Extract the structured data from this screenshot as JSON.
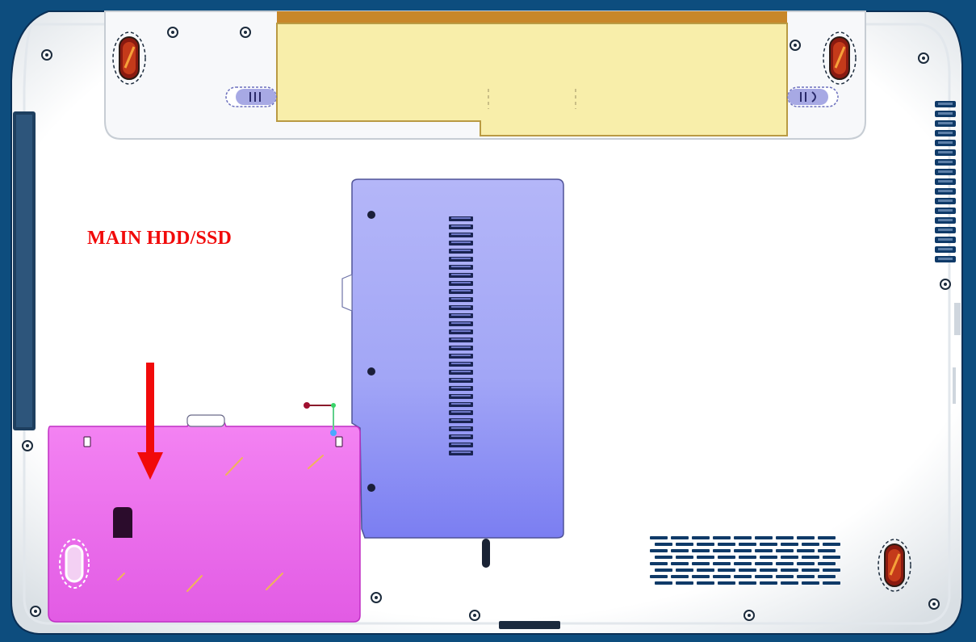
{
  "callout": {
    "label": "MAIN HDD/SSD",
    "color": "#f10a0a"
  },
  "colors": {
    "background": "#0d4d7e",
    "chassis": "#f4f6f8",
    "battery": "#f8eeaa",
    "battery_top": "#c8872a",
    "memory_cover": "#a9acf9",
    "hdd_cover": "#f57af4",
    "vent": "#0f3a68",
    "latch": "#a7a9e4",
    "rubber_foot": "#8a1a10"
  },
  "components": [
    {
      "id": "battery",
      "icon": "battery-pack"
    },
    {
      "id": "battery-latch-left",
      "icon": "latch"
    },
    {
      "id": "battery-latch-right",
      "icon": "latch"
    },
    {
      "id": "memory-cover",
      "icon": "access-panel"
    },
    {
      "id": "hdd-cover",
      "icon": "access-panel"
    },
    {
      "id": "side-vent",
      "icon": "vent"
    },
    {
      "id": "bottom-vent",
      "icon": "vent"
    },
    {
      "id": "rubber-feet",
      "icon": "rubber-foot"
    },
    {
      "id": "screws",
      "icon": "screw"
    },
    {
      "id": "arrow",
      "icon": "down-arrow"
    }
  ]
}
